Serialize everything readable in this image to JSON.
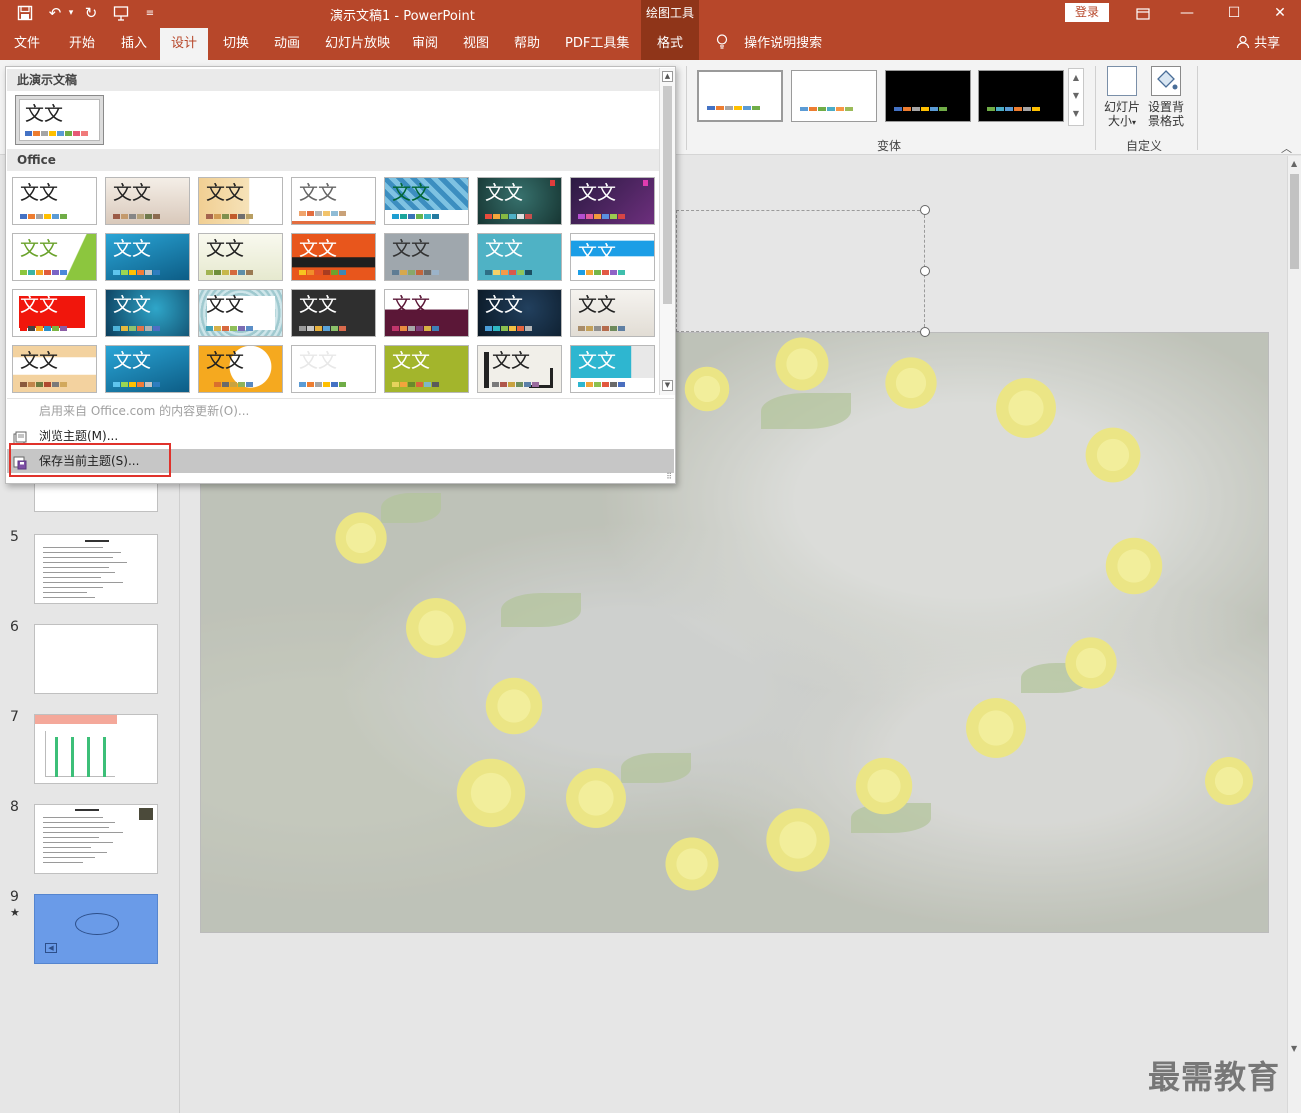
{
  "titlebar": {
    "title": "演示文稿1  -  PowerPoint",
    "context_tab_header": "绘图工具",
    "login": "登录",
    "minimize": "—",
    "restore": "☐",
    "close": "✕"
  },
  "tabs": [
    {
      "id": "file",
      "label": "文件"
    },
    {
      "id": "home",
      "label": "开始"
    },
    {
      "id": "insert",
      "label": "插入"
    },
    {
      "id": "design",
      "label": "设计",
      "active": true
    },
    {
      "id": "transitions",
      "label": "切换"
    },
    {
      "id": "animations",
      "label": "动画"
    },
    {
      "id": "slideshow",
      "label": "幻灯片放映"
    },
    {
      "id": "review",
      "label": "审阅"
    },
    {
      "id": "view",
      "label": "视图"
    },
    {
      "id": "help",
      "label": "帮助"
    },
    {
      "id": "pdf",
      "label": "PDF工具集"
    },
    {
      "id": "format",
      "label": "格式"
    }
  ],
  "tell_me": "操作说明搜索",
  "share": "共享",
  "ribbon": {
    "variants_label": "变体",
    "customize_label": "自定义",
    "slide_size_label_1": "幻灯片",
    "slide_size_label_2": "大小",
    "bg_format_label_1": "设置背",
    "bg_format_label_2": "景格式"
  },
  "dropdown": {
    "this_presentation_header": "此演示文稿",
    "office_header": "Office",
    "theme_sample_text": "文文",
    "menu_enable_updates": "启用来自 Office.com 的内容更新(O)...",
    "menu_browse": "浏览主题(M)...",
    "menu_save": "保存当前主题(S)..."
  },
  "slides": {
    "numbers": [
      "5",
      "6",
      "7",
      "8",
      "9"
    ],
    "star": "★"
  },
  "watermark": "最需教育",
  "colors": {
    "accent": "#b7472a",
    "accent_dark": "#8f3519",
    "highlight_box": "#e0322b"
  }
}
